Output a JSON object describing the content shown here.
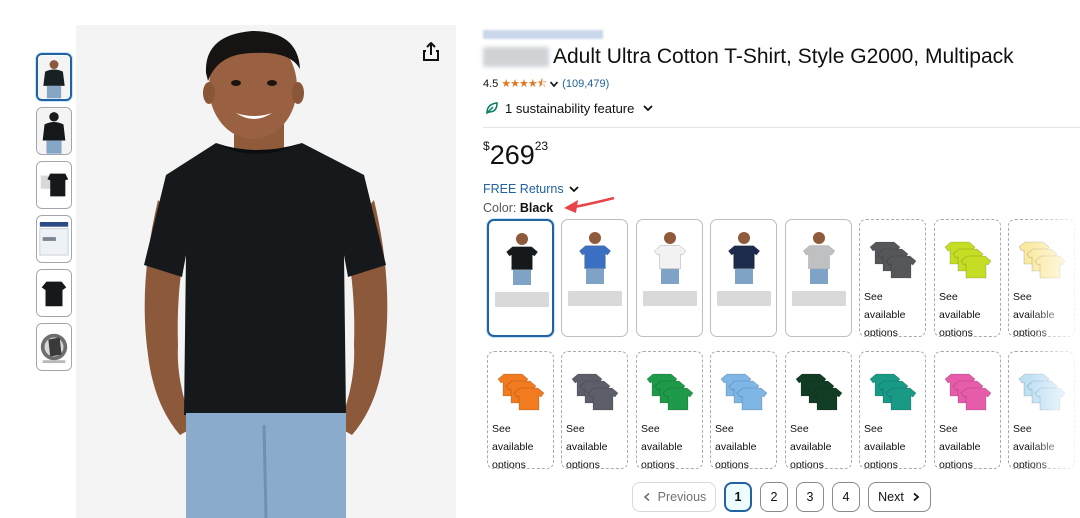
{
  "product": {
    "title": "Adult Ultra Cotton T-Shirt, Style G2000, Multipack",
    "rating": "4.5",
    "stars": "★★★★⯪",
    "review_count": "(109,479)",
    "sustainability": "1 sustainability feature",
    "price_symbol": "$",
    "price_whole": "269",
    "price_fraction": "23",
    "returns": "FREE Returns",
    "color_label": "Color:",
    "color_value": "Black"
  },
  "thumbnails": [
    "man-black-tee-front",
    "man-black-tee-back",
    "black-tee-flat-box",
    "packaged-multipack",
    "black-tee-flat",
    "video-thumbnail"
  ],
  "swatches": {
    "row1": [
      {
        "name": "black",
        "color": "#15191c",
        "type": "model",
        "text": ""
      },
      {
        "name": "royal-blue",
        "color": "#3a6fc1",
        "type": "model",
        "text": ""
      },
      {
        "name": "white",
        "color": "#f2f2f2",
        "type": "model",
        "text": ""
      },
      {
        "name": "navy",
        "color": "#1c2b4c",
        "type": "model",
        "text": ""
      },
      {
        "name": "sport-grey",
        "color": "#bfc0c2",
        "type": "model",
        "text": ""
      },
      {
        "name": "charcoal",
        "color": "#55575a",
        "type": "stack",
        "text": "See\navailable\noptions"
      },
      {
        "name": "safety-green",
        "color": "#c5dd25",
        "type": "stack",
        "text": "See\navailable\noptions"
      },
      {
        "name": "cornsilk",
        "color": "#fbe9a2",
        "type": "stack",
        "text": "See\navailable\noptions"
      }
    ],
    "row2": [
      {
        "name": "orange",
        "color": "#f27b1f",
        "type": "stack",
        "text": "See\navailable\noptions"
      },
      {
        "name": "dark-heather",
        "color": "#5c5f6a",
        "type": "stack",
        "text": "See\navailable\noptions"
      },
      {
        "name": "irish-green",
        "color": "#1f9a4a",
        "type": "stack",
        "text": "See\navailable\noptions"
      },
      {
        "name": "carolina-blue",
        "color": "#7eb6e6",
        "type": "stack",
        "text": "See\navailable\noptions"
      },
      {
        "name": "forest-green",
        "color": "#123d25",
        "type": "stack",
        "text": "See\navailable\noptions"
      },
      {
        "name": "jade-dome",
        "color": "#199a86",
        "type": "stack",
        "text": "See\navailable\noptions"
      },
      {
        "name": "azalea",
        "color": "#e65cab",
        "type": "stack",
        "text": "See\navailable\noptions"
      },
      {
        "name": "light-blue",
        "color": "#bfe1f4",
        "type": "stack",
        "text": "See\navailable\noptions"
      }
    ]
  },
  "pagination": {
    "previous": "Previous",
    "pages": [
      "1",
      "2",
      "3",
      "4"
    ],
    "next": "Next"
  },
  "colors": {
    "link": "#2162a1",
    "star": "#de7921",
    "selected_border": "#2162a1",
    "annotation_arrow": "#e8454a"
  }
}
